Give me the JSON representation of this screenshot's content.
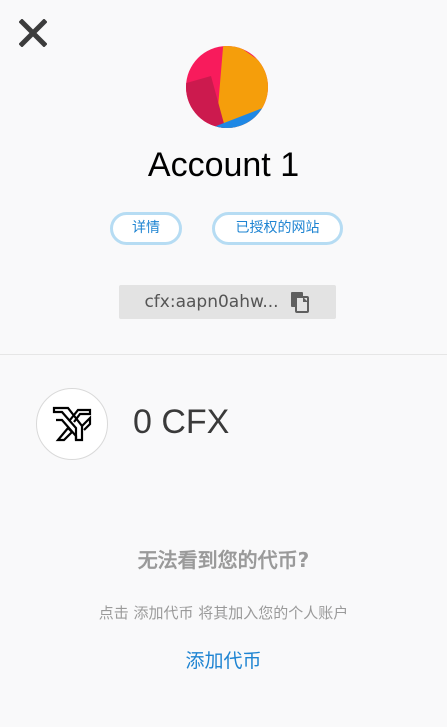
{
  "header": {
    "close_icon": "close-icon",
    "account_name": "Account 1",
    "details_button": "详情",
    "connected_sites_button": "已授权的网站",
    "address": "cfx:aapn0ahw...",
    "copy_icon": "copy-icon"
  },
  "balance": {
    "token_icon": "conflux-logo-icon",
    "amount": "0 CFX"
  },
  "prompt": {
    "title": "无法看到您的代币?",
    "description": "点击 添加代币 将其加入您的个人账户",
    "link": "添加代币"
  },
  "colors": {
    "link": "#1e84d2",
    "pill_border": "#b6dcf3",
    "avatar_pink": "#f81b5c",
    "avatar_orange": "#f59e0b",
    "avatar_crimson": "#cc1a4e",
    "avatar_blue": "#1e88e5"
  }
}
